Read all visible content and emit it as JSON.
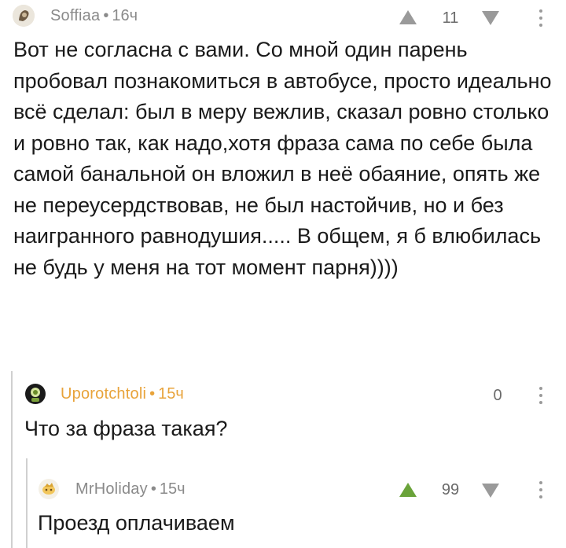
{
  "comments": [
    {
      "author": "Soffiaa",
      "time": "16ч",
      "rating": "11",
      "text": "Вот не согласна с вами. Со мной один парень пробовал познакомиться в автобусе, просто идеально всё сделал: был в меру вежлив, сказал ровно столько и ровно так, как надо,хотя фраза сама по себе была самой банальной он вложил в неё обаяние, опять же не переусердствовав, не был настойчив, но и без наигранного равнодушия..... В общем, я б влюбилась не будь у меня на тот момент парня))))"
    },
    {
      "author": "Uporotchtoli",
      "time": "15ч",
      "rating": "0",
      "text": "Что за фраза такая?",
      "author_color": "#e8a33a"
    },
    {
      "author": "MrHoliday",
      "time": "15ч",
      "rating": "99",
      "text": "Проезд оплачиваем",
      "upvote_color": "#6aa33a"
    }
  ],
  "separator": "•"
}
